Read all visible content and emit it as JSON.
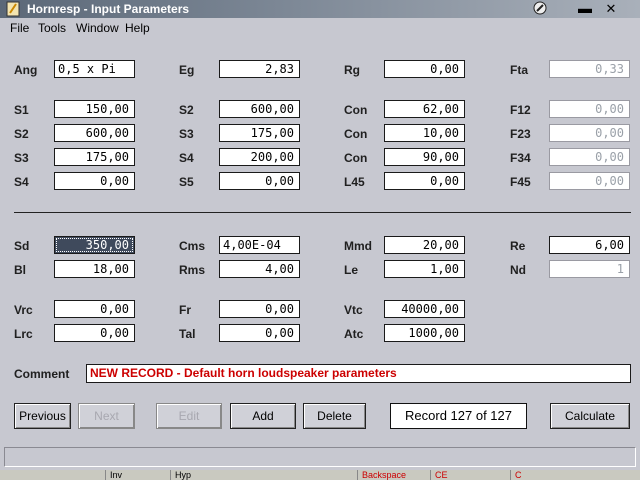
{
  "window": {
    "title": "Hornresp - Input Parameters"
  },
  "menu": [
    "File",
    "Tools",
    "Window",
    "Help"
  ],
  "params": {
    "ang": {
      "label": "Ang",
      "value": "0,5 x Pi"
    },
    "eg": {
      "label": "Eg",
      "value": "2,83"
    },
    "rg": {
      "label": "Rg",
      "value": "0,00"
    },
    "fta": {
      "label": "Fta",
      "value": "0,33"
    },
    "s1": {
      "label": "S1",
      "value": "150,00"
    },
    "s2a": {
      "label": "S2",
      "value": "600,00"
    },
    "con1": {
      "label": "Con",
      "value": "62,00"
    },
    "f12": {
      "label": "F12",
      "value": "0,00"
    },
    "s2": {
      "label": "S2",
      "value": "600,00"
    },
    "s3a": {
      "label": "S3",
      "value": "175,00"
    },
    "con2": {
      "label": "Con",
      "value": "10,00"
    },
    "f23": {
      "label": "F23",
      "value": "0,00"
    },
    "s3": {
      "label": "S3",
      "value": "175,00"
    },
    "s4a": {
      "label": "S4",
      "value": "200,00"
    },
    "con3": {
      "label": "Con",
      "value": "90,00"
    },
    "f34": {
      "label": "F34",
      "value": "0,00"
    },
    "s4": {
      "label": "S4",
      "value": "0,00"
    },
    "s5": {
      "label": "S5",
      "value": "0,00"
    },
    "l45": {
      "label": "L45",
      "value": "0,00"
    },
    "f45": {
      "label": "F45",
      "value": "0,00"
    },
    "sd": {
      "label": "Sd",
      "value": "350,00"
    },
    "cms": {
      "label": "Cms",
      "value": "4,00E-04"
    },
    "mmd": {
      "label": "Mmd",
      "value": "20,00"
    },
    "re": {
      "label": "Re",
      "value": "6,00"
    },
    "bl": {
      "label": "Bl",
      "value": "18,00"
    },
    "rms": {
      "label": "Rms",
      "value": "4,00"
    },
    "le": {
      "label": "Le",
      "value": "1,00"
    },
    "nd": {
      "label": "Nd",
      "value": "1"
    },
    "vrc": {
      "label": "Vrc",
      "value": "0,00"
    },
    "fr": {
      "label": "Fr",
      "value": "0,00"
    },
    "vtc": {
      "label": "Vtc",
      "value": "40000,00"
    },
    "lrc": {
      "label": "Lrc",
      "value": "0,00"
    },
    "tal": {
      "label": "Tal",
      "value": "0,00"
    },
    "atc": {
      "label": "Atc",
      "value": "1000,00"
    }
  },
  "comment": {
    "label": "Comment",
    "value": "NEW RECORD - Default horn loudspeaker parameters"
  },
  "buttons": {
    "previous": "Previous",
    "next": "Next",
    "edit": "Edit",
    "add": "Add",
    "delete": "Delete",
    "calculate": "Calculate"
  },
  "record": "Record 127 of 127",
  "taskbar": [
    "Inv",
    "Hyp",
    "Backspace",
    "CE",
    "C"
  ],
  "colors": {
    "comment_text": "#cc0000",
    "title_gradient_start": "#5b6878"
  }
}
